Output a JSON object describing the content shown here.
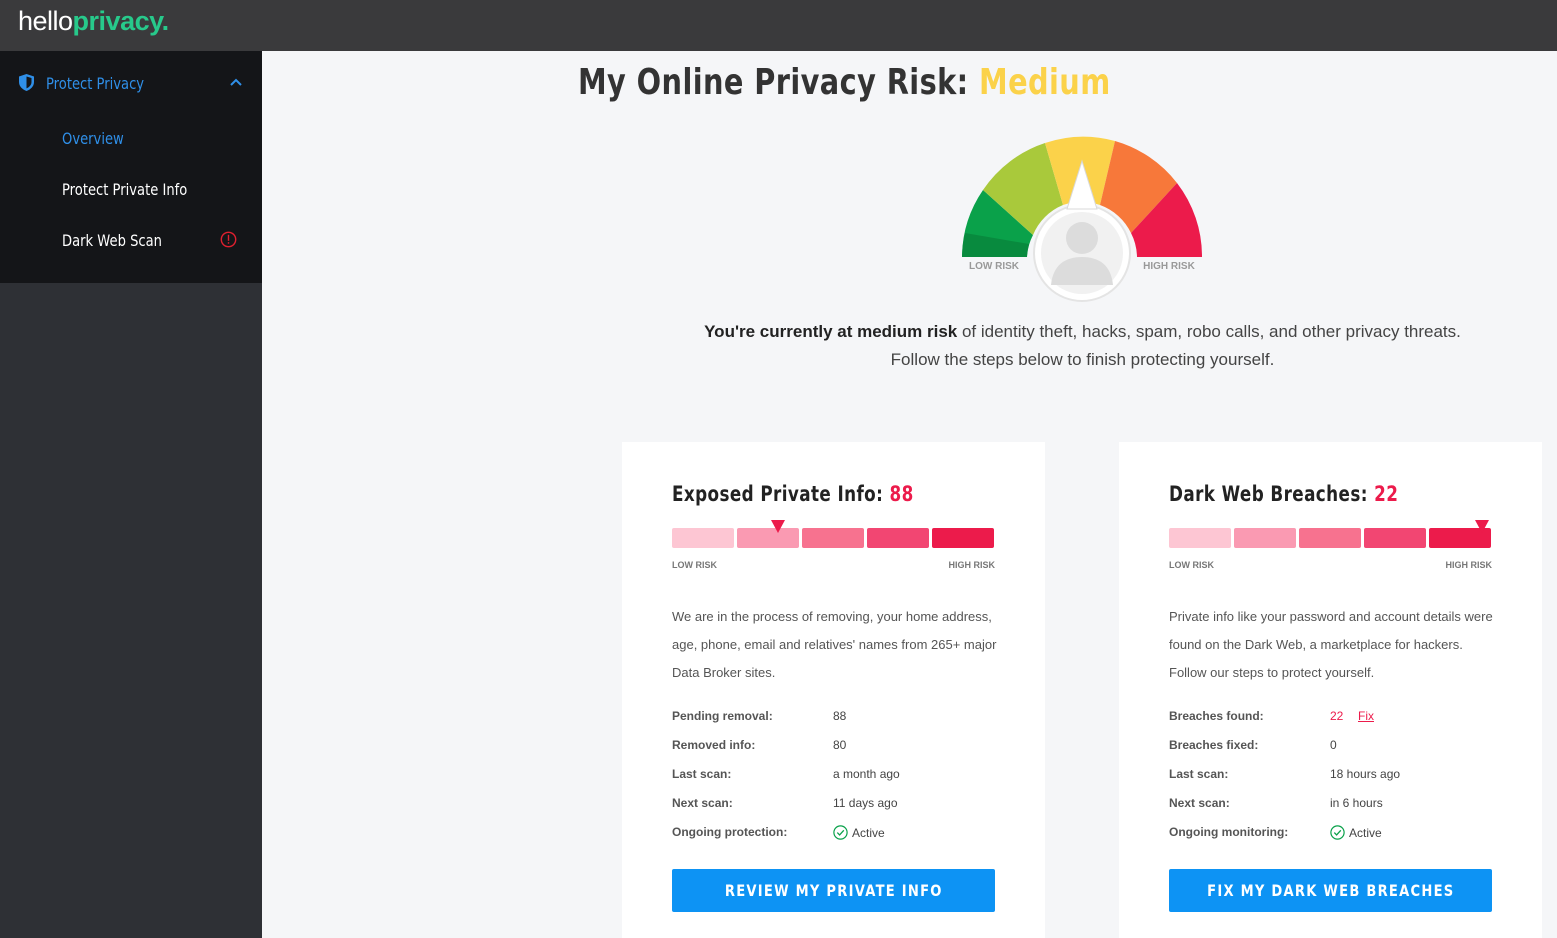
{
  "brand": {
    "logo_part1": "hello",
    "logo_part2": "privacy."
  },
  "sidebar": {
    "section_label": "Protect Privacy",
    "items": [
      {
        "label": "Overview",
        "active": true
      },
      {
        "label": "Protect Private Info",
        "active": false
      },
      {
        "label": "Dark Web Scan",
        "active": false,
        "alert": true
      }
    ]
  },
  "main": {
    "title_prefix": "My Online Privacy Risk: ",
    "title_level": "Medium",
    "gauge": {
      "low_label": "LOW RISK",
      "high_label": "HIGH RISK",
      "level": "medium"
    },
    "intro_bold": "You're currently at medium risk",
    "intro_rest": " of identity theft, hacks, spam, robo calls, and other privacy threats. Follow the steps below to finish protecting yourself."
  },
  "cards": [
    {
      "title": "Exposed Private Info: ",
      "count": "88",
      "marker_segment": 2,
      "low_label": "LOW RISK",
      "high_label": "HIGH RISK",
      "description": "We are in the process of removing, your home address, age, phone, email and relatives' names from 265+ major Data Broker sites.",
      "stats": [
        {
          "label": "Pending removal:",
          "value": "88"
        },
        {
          "label": "Removed info:",
          "value": "80"
        },
        {
          "label": "Last scan:",
          "value": "a month ago"
        },
        {
          "label": "Next scan:",
          "value": "11 days ago"
        },
        {
          "label": "Ongoing protection:",
          "value": "Active"
        }
      ],
      "button": "REVIEW MY PRIVATE INFO"
    },
    {
      "title": "Dark Web Breaches: ",
      "count": "22",
      "marker_segment": 5,
      "low_label": "LOW RISK",
      "high_label": "HIGH RISK",
      "description": "Private info like your password and account details were found on the Dark Web, a marketplace for hackers. Follow our steps to protect yourself.",
      "stats": [
        {
          "label": "Breaches found:",
          "value": "22",
          "link": "Fix"
        },
        {
          "label": "Breaches fixed:",
          "value": "0"
        },
        {
          "label": "Last scan:",
          "value": "18 hours ago"
        },
        {
          "label": "Next scan:",
          "value": "in 6 hours"
        },
        {
          "label": "Ongoing monitoring:",
          "value": "Active"
        }
      ],
      "button": "FIX MY DARK WEB BREACHES"
    }
  ],
  "colors": {
    "accent_blue": "#0d93f4",
    "brand_green": "#27c98b",
    "risk_medium": "#fbd24a",
    "risk_red": "#ec1b4b",
    "segments": [
      "#fdc6d3",
      "#fa9ab2",
      "#f7728f",
      "#f24672",
      "#ec1b4b"
    ]
  }
}
